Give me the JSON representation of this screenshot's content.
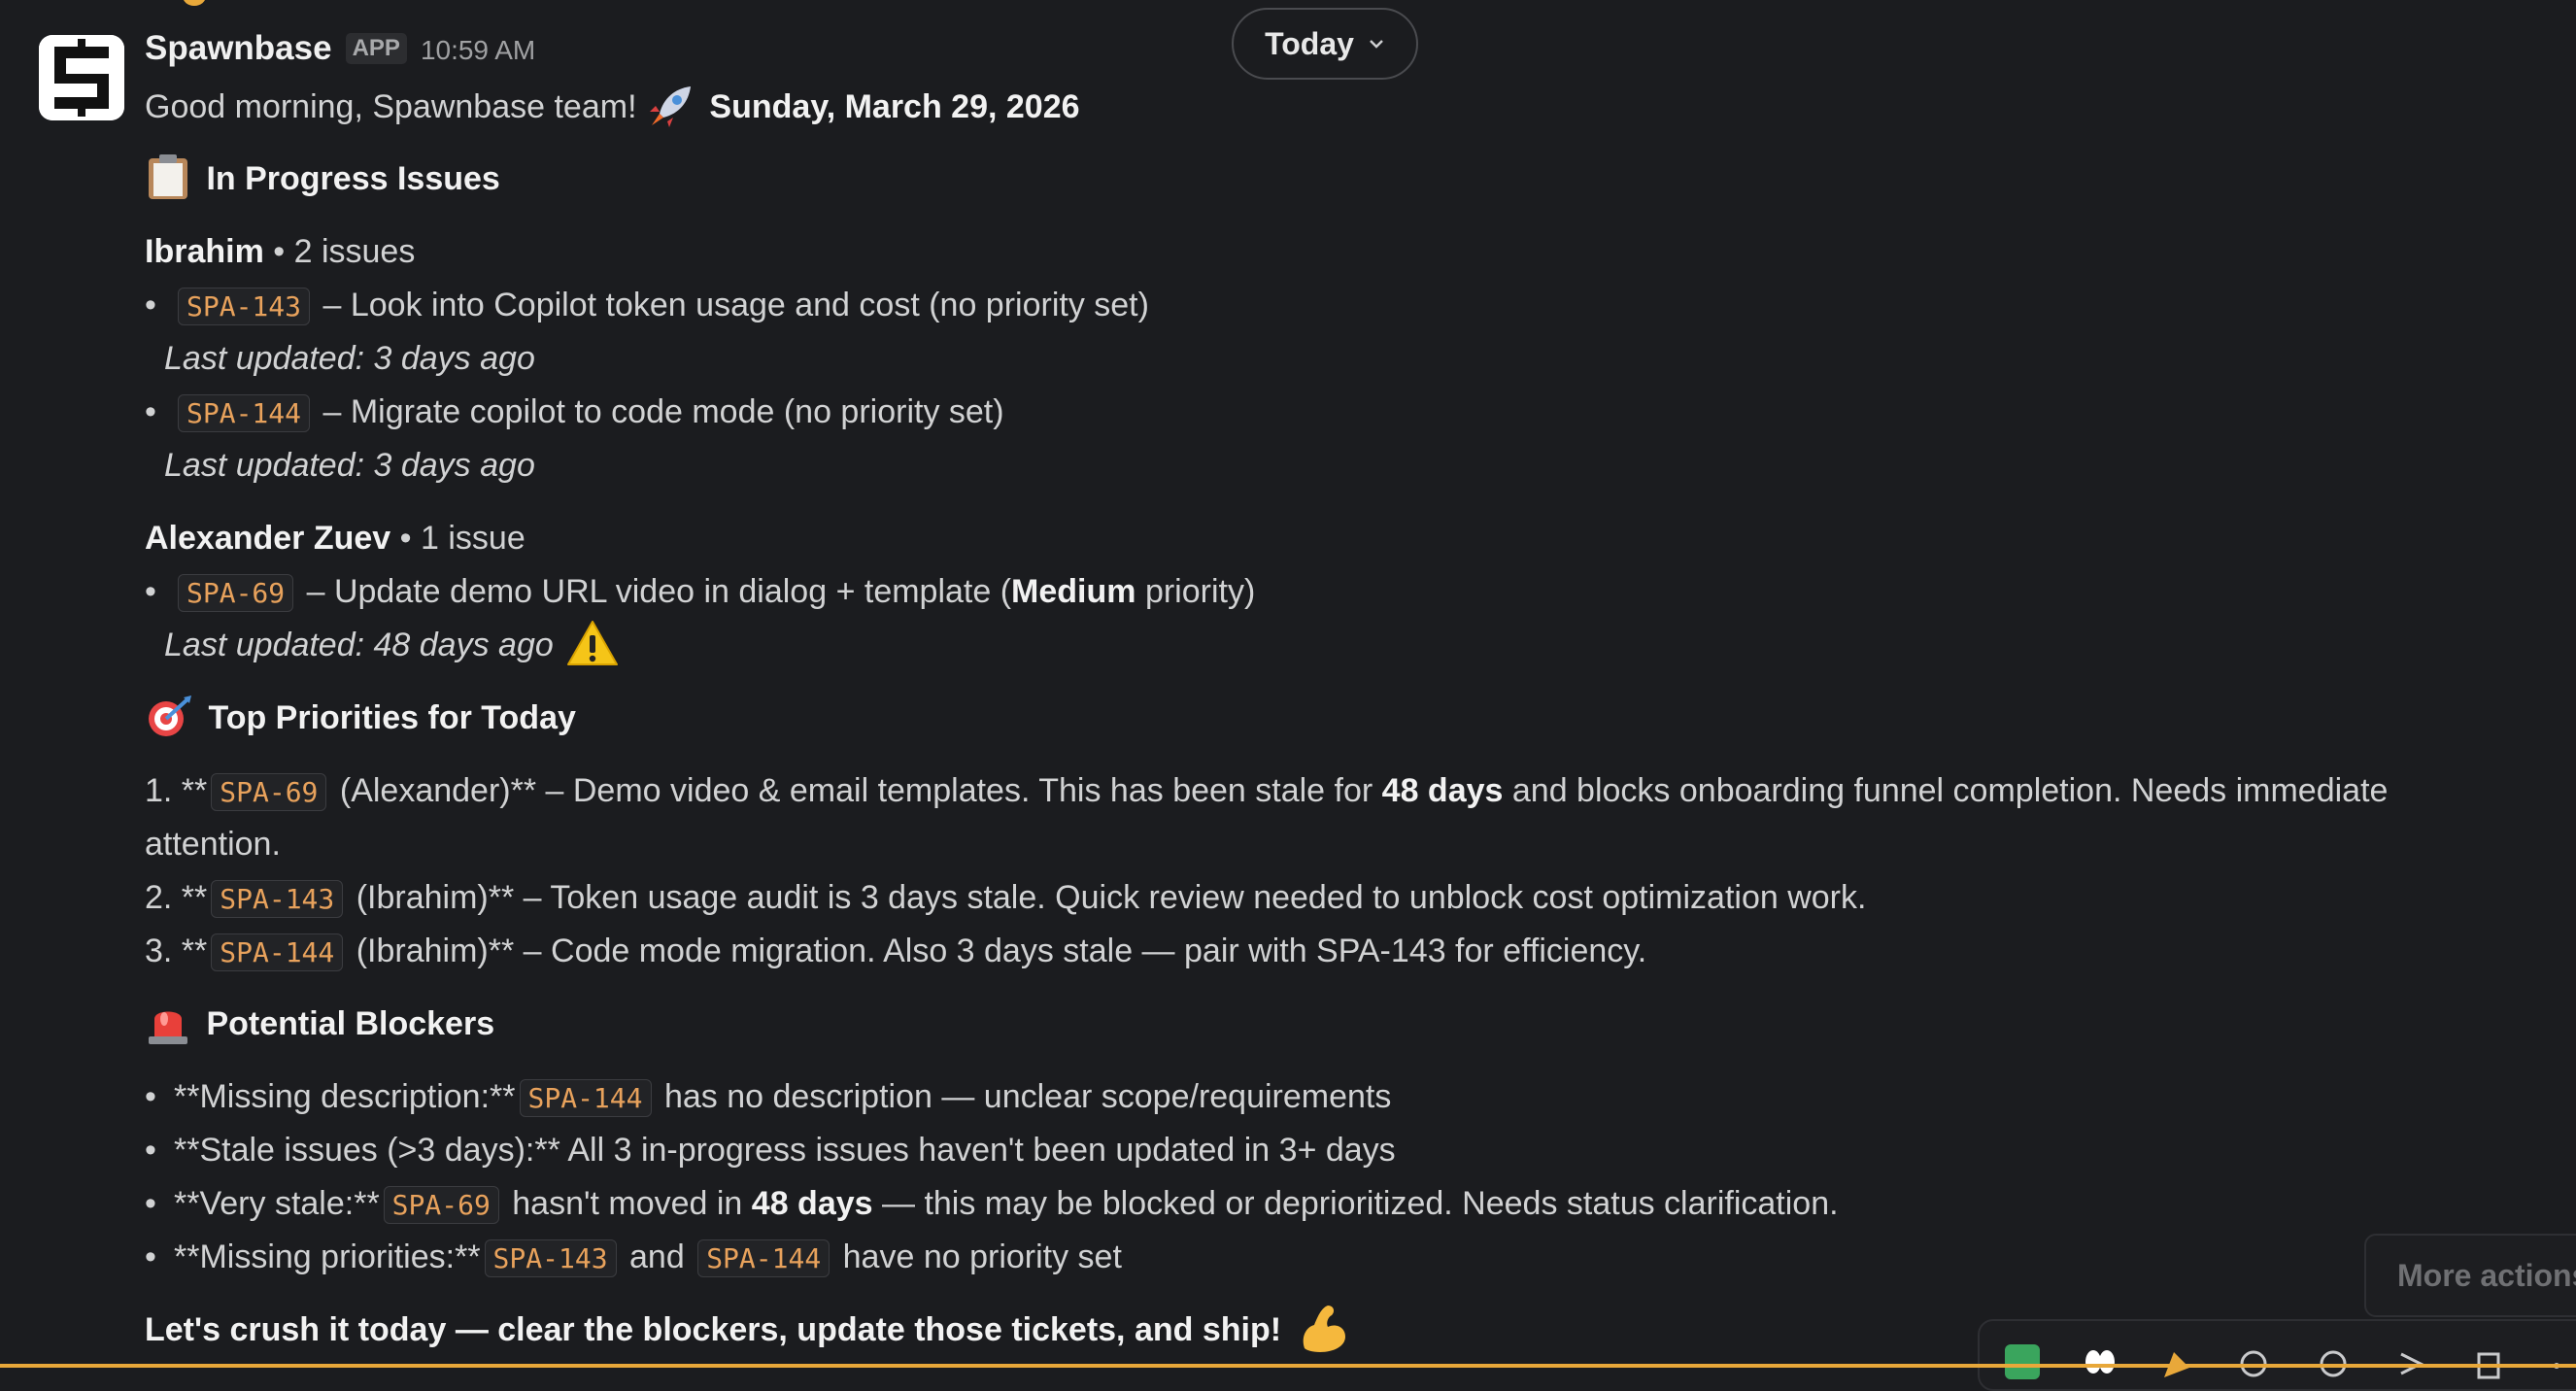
{
  "today_pill": {
    "label": "Today"
  },
  "message": {
    "sender": "Spawnbase",
    "badge": "APP",
    "time": "10:59 AM",
    "greeting": "Good morning, Spawnbase team!",
    "date": "Sunday, March 29, 2026",
    "in_progress": {
      "title": "In Progress Issues",
      "groups": [
        {
          "name": "Ibrahim",
          "count": " • 2 issues",
          "items": [
            {
              "id": "SPA-143",
              "text": " – Look into Copilot token usage and cost (no priority set)",
              "updated": "Last updated: 3 days ago"
            },
            {
              "id": "SPA-144",
              "text": " – Migrate copilot to code mode (no priority set)",
              "updated": "Last updated: 3 days ago"
            }
          ]
        },
        {
          "name": "Alexander Zuev",
          "count": " • 1 issue",
          "items": [
            {
              "id": "SPA-69",
              "text_pre": " – Update demo URL video in dialog + template (",
              "text_bold": "Medium",
              "text_post": " priority)",
              "updated": "Last updated: 48 days ago"
            }
          ]
        }
      ]
    },
    "top_priorities": {
      "title": "Top Priorities for Today",
      "items": [
        {
          "num": "1. **",
          "id": "SPA-69",
          "pre": " (Alexander)** – Demo video & email templates. This has been stale for ",
          "bold": "48 days",
          "post": " and blocks onboarding funnel completion. Needs immediate",
          "cont": "attention."
        },
        {
          "num": "2. **",
          "id": "SPA-143",
          "text": " (Ibrahim)** – Token usage audit is 3 days stale. Quick review needed to unblock cost optimization work."
        },
        {
          "num": "3. **",
          "id": "SPA-144",
          "text": " (Ibrahim)** – Code mode migration. Also 3 days stale — pair with SPA-143 for efficiency."
        }
      ]
    },
    "blockers": {
      "title": "Potential Blockers",
      "items": [
        {
          "pre": "**Missing description:**",
          "id": "SPA-144",
          "post": " has no description — unclear scope/requirements"
        },
        {
          "text": "**Stale issues (>3 days):** All 3 in-progress issues haven't been updated in 3+ days"
        },
        {
          "pre": "**Very stale:**",
          "id": "SPA-69",
          "mid": " hasn't moved in ",
          "bold": "48 days",
          "post": " — this may be blocked or deprioritized. Needs status clarification."
        },
        {
          "pre": "**Missing priorities:**",
          "id": "SPA-143",
          "mid": " and ",
          "id2": "SPA-144",
          "post": " have no priority set"
        }
      ]
    },
    "closing": "Let's crush it today — clear the blockers, update those tickets, and ship!"
  },
  "more_actions": {
    "label": "More actions"
  },
  "icons": {
    "avatar": "spawnbase-logo",
    "rocket": "rocket-icon",
    "clipboard": "clipboard-icon",
    "warning": "warning-icon",
    "target": "target-icon",
    "siren": "siren-icon",
    "muscle": "flexed-biceps-icon",
    "chevron": "chevron-down-icon"
  },
  "colors": {
    "background": "#1b1c1f",
    "code_text": "#e8a25c",
    "text": "#d1d2d3"
  }
}
